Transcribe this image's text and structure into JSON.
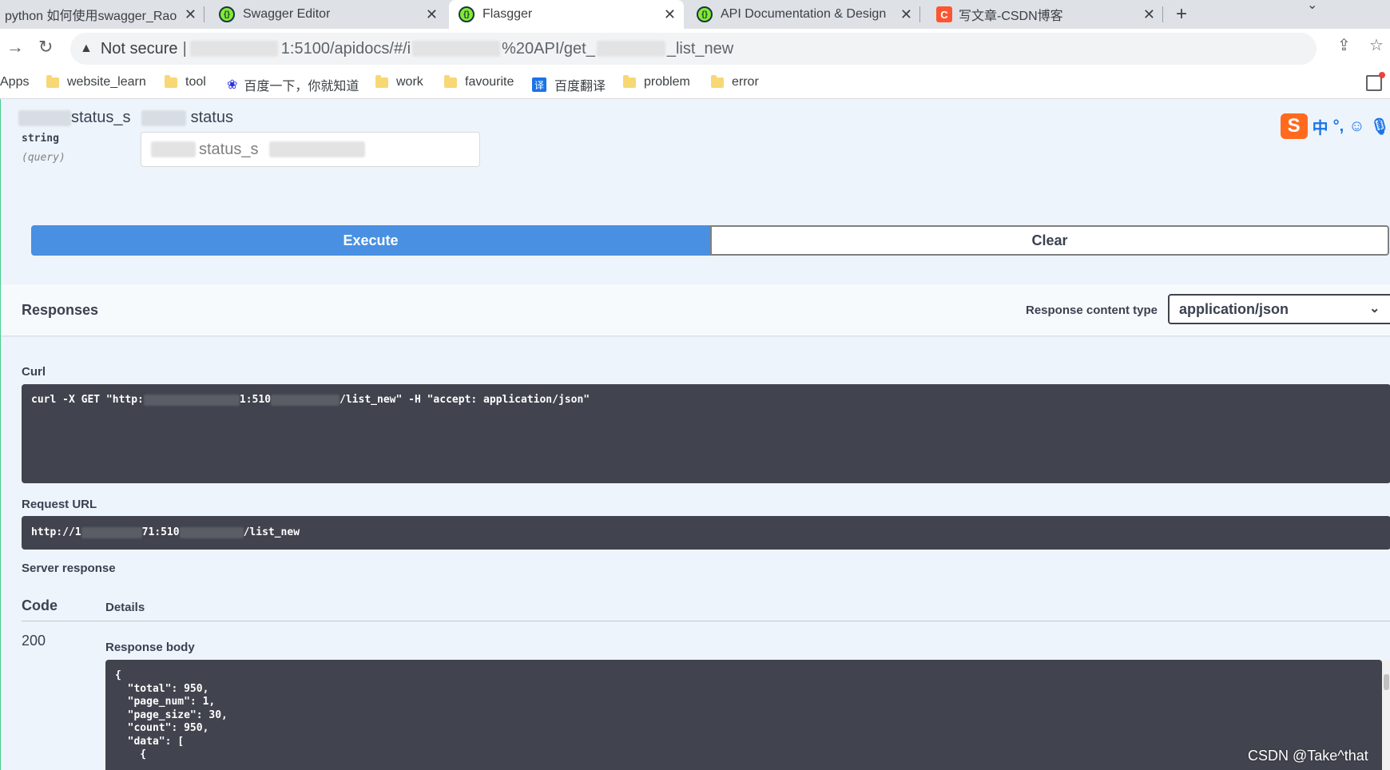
{
  "browser": {
    "tabs": [
      {
        "title": "python 如何使用swagger_Rao",
        "icon": "generic"
      },
      {
        "title": "Swagger Editor",
        "icon": "swagger"
      },
      {
        "title": "Flasgger",
        "icon": "swagger",
        "active": true
      },
      {
        "title": "API Documentation & Design",
        "icon": "swagger"
      },
      {
        "title": "写文章-CSDN博客",
        "icon": "csdn"
      }
    ],
    "close_glyph": "✕",
    "new_tab_glyph": "+",
    "address": {
      "security_label": "Not secure",
      "url_part1": "1:5100/apidocs/#/i",
      "url_part2": "%20API/get_",
      "url_part3": "_list_new"
    },
    "bookmarks": [
      {
        "label": "Apps",
        "icon": "apps"
      },
      {
        "label": "website_learn",
        "icon": "folder"
      },
      {
        "label": "tool",
        "icon": "folder"
      },
      {
        "label": "百度一下，你就知道",
        "icon": "baidu"
      },
      {
        "label": "work",
        "icon": "folder"
      },
      {
        "label": "favourite",
        "icon": "folder"
      },
      {
        "label": "百度翻译",
        "icon": "fanyi"
      },
      {
        "label": "problem",
        "icon": "folder"
      },
      {
        "label": "error",
        "icon": "folder"
      }
    ],
    "fanyi_glyph": "译",
    "csdn_glyph": "C"
  },
  "parameter": {
    "name_part1": "status_s",
    "name_part2": "status",
    "type": "string",
    "in": "(query)",
    "input_value": "status_s"
  },
  "ime": {
    "logo": "S",
    "lang": "中",
    "punct": "°,",
    "emoji": "☺",
    "mic": "🎙"
  },
  "buttons": {
    "execute": "Execute",
    "clear": "Clear"
  },
  "responses": {
    "title": "Responses",
    "content_type_label": "Response content type",
    "content_type_value": "application/json",
    "curl_label": "Curl",
    "curl_part1": "curl -X GET \"http:",
    "curl_part2": "1:510",
    "curl_part3": "/list_new\" -H \"accept: application/json\"",
    "request_url_label": "Request URL",
    "request_url_part1": "http://1",
    "request_url_part2": "71:510",
    "request_url_part3": "/list_new",
    "server_response_label": "Server response",
    "code_header": "Code",
    "details_header": "Details",
    "status_code": "200",
    "response_body_label": "Response body",
    "body_lines": [
      "{",
      "  \"total\": 950,",
      "  \"page_num\": 1,",
      "  \"page_size\": 30,",
      "  \"count\": 950,",
      "  \"data\": [",
      "    {"
    ]
  },
  "watermark": "CSDN @Take^that"
}
